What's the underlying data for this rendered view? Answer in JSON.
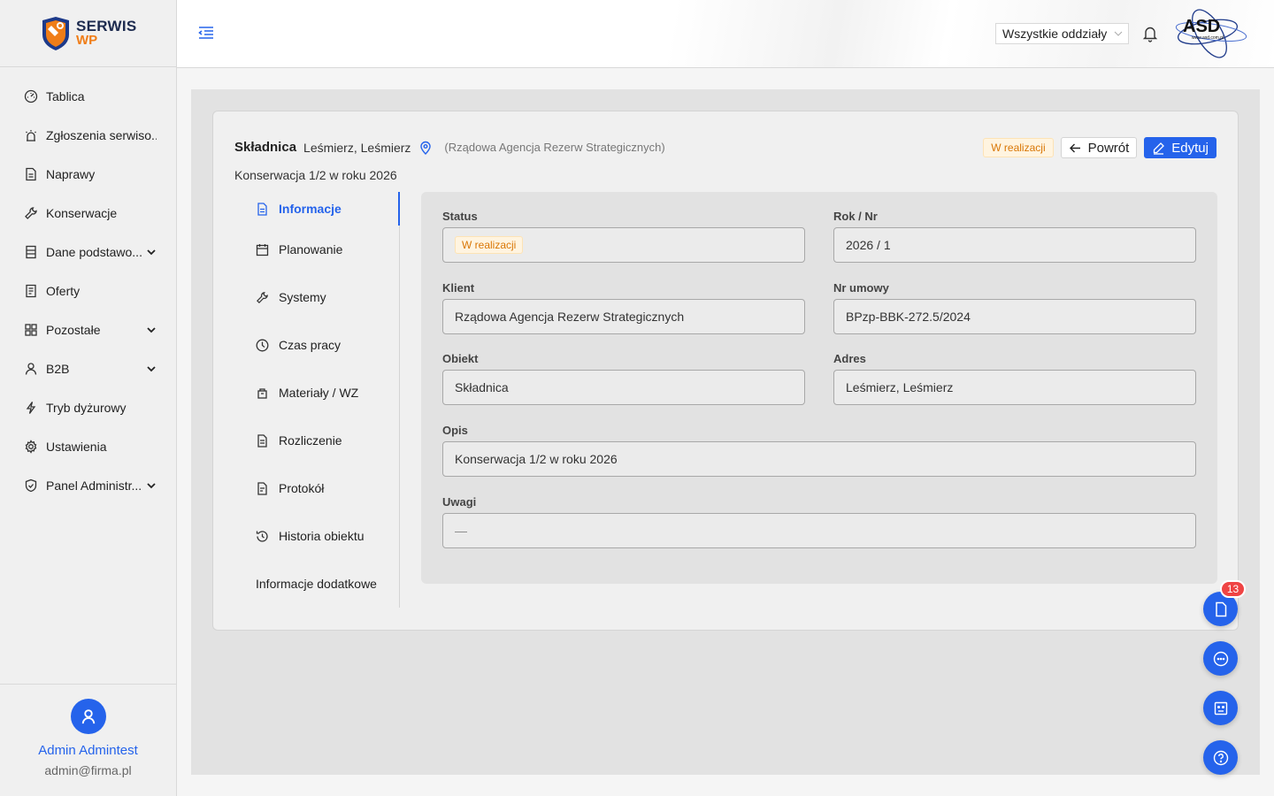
{
  "app": {
    "logo_line1": "SERWIS",
    "logo_line2": "WP",
    "brand_color": "#2563eb",
    "accent_orange": "#f07d17"
  },
  "sidebar": {
    "items": [
      {
        "label": "Tablica",
        "icon": "dashboard-icon"
      },
      {
        "label": "Zgłoszenia serwiso...",
        "icon": "alarm-icon"
      },
      {
        "label": "Naprawy",
        "icon": "document-icon"
      },
      {
        "label": "Konserwacje",
        "icon": "wrench-icon"
      },
      {
        "label": "Dane podstawo...",
        "icon": "database-icon",
        "has_submenu": true
      },
      {
        "label": "Oferty",
        "icon": "offer-icon"
      },
      {
        "label": "Pozostałe",
        "icon": "grid-icon",
        "has_submenu": true
      },
      {
        "label": "B2B",
        "icon": "user-icon",
        "has_submenu": true
      },
      {
        "label": "Tryb dyżurowy",
        "icon": "lightning-icon"
      },
      {
        "label": "Ustawienia",
        "icon": "gear-icon"
      },
      {
        "label": "Panel Administr...",
        "icon": "shield-icon",
        "has_submenu": true
      }
    ]
  },
  "user": {
    "name": "Admin Admintest",
    "email": "admin@firma.pl"
  },
  "header": {
    "branch_select": "Wszystkie oddziały",
    "asd_logo": "ASD",
    "asd_url": "www.asd.com.pl"
  },
  "card": {
    "object_name": "Składnica",
    "object_address": "Leśmierz, Leśmierz",
    "client_paren": "(Rządowa Agencja Rezerw Strategicznych)",
    "subtitle": "Konserwacja 1/2 w roku 2026",
    "status_badge": "W realizacji",
    "back_label": "Powrót",
    "edit_label": "Edytuj"
  },
  "tabs": [
    {
      "label": "Informacje",
      "icon": "document-icon",
      "active": true
    },
    {
      "label": "Planowanie",
      "icon": "calendar-icon"
    },
    {
      "label": "Systemy",
      "icon": "wrench-icon"
    },
    {
      "label": "Czas pracy",
      "icon": "clock-icon"
    },
    {
      "label": "Materiały / WZ",
      "icon": "box-icon"
    },
    {
      "label": "Rozliczenie",
      "icon": "invoice-icon"
    },
    {
      "label": "Protokół",
      "icon": "protocol-icon"
    },
    {
      "label": "Historia obiektu",
      "icon": "history-icon"
    },
    {
      "label": "Informacje dodatkowe",
      "icon": ""
    }
  ],
  "fields": {
    "status": {
      "label": "Status",
      "value": "W realizacji"
    },
    "year_nr": {
      "label": "Rok / Nr",
      "value": "2026 / 1"
    },
    "client": {
      "label": "Klient",
      "value": "Rządowa Agencja Rezerw Strategicznych"
    },
    "contract": {
      "label": "Nr umowy",
      "value": "BPzp-BBK-272.5/2024"
    },
    "object": {
      "label": "Obiekt",
      "value": "Składnica"
    },
    "address": {
      "label": "Adres",
      "value": "Leśmierz, Leśmierz"
    },
    "description": {
      "label": "Opis",
      "value": "Konserwacja 1/2 w roku 2026"
    },
    "notes": {
      "label": "Uwagi",
      "value": "—"
    }
  },
  "floating": {
    "documents_count": "13"
  }
}
